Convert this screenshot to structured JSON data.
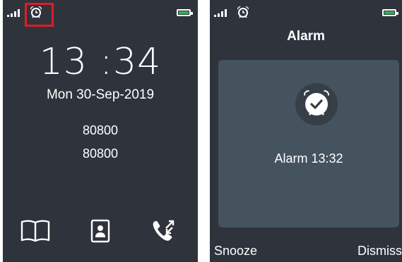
{
  "home_screen": {
    "time": "13 :34",
    "date": "Mon 30-Sep-2019",
    "line1": "80800",
    "line2": "80800",
    "icons": [
      "signal-icon",
      "alarm-clock-icon",
      "battery-icon",
      "phonebook-icon",
      "contact-card-icon",
      "call-log-icon"
    ]
  },
  "alarm_screen": {
    "title": "Alarm",
    "message": "Alarm 13:32",
    "left_softkey": "Snooze",
    "right_softkey": "Dismiss",
    "icons": [
      "signal-icon",
      "alarm-clock-icon",
      "battery-icon",
      "alarm-check-icon"
    ]
  },
  "colors": {
    "screen_bg": "#2e333c",
    "card_bg": "#45535f",
    "battery": "#24b84a",
    "highlight": "#e21b24"
  }
}
